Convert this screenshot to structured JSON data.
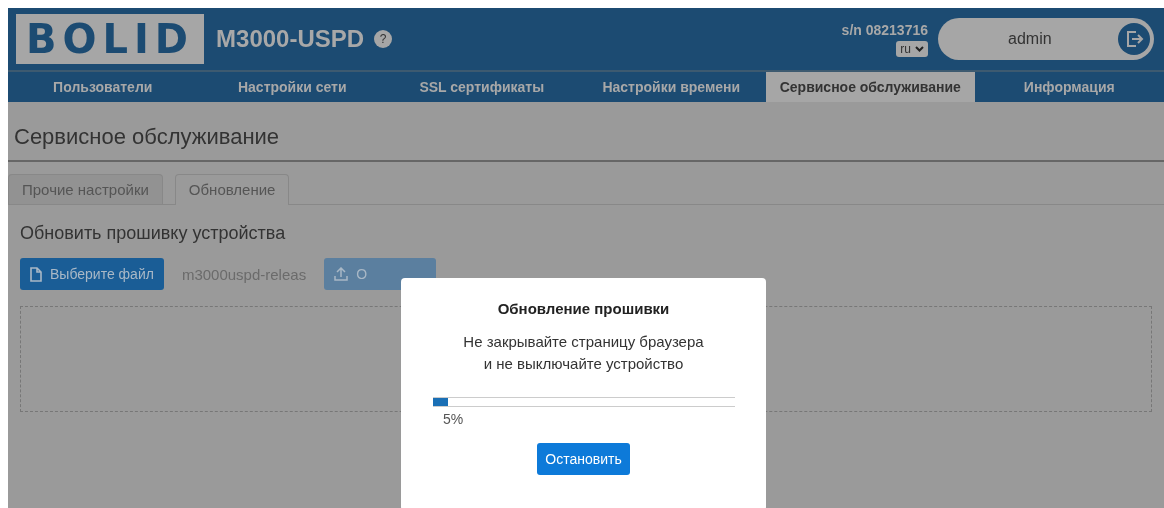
{
  "header": {
    "logo": "BOLID",
    "device": "M3000-USPD",
    "help": "?",
    "serial": "s/n 08213716",
    "language": "ru",
    "user": "admin"
  },
  "nav": [
    {
      "label": "Пользователи",
      "selected": false
    },
    {
      "label": "Настройки сети",
      "selected": false
    },
    {
      "label": "SSL сертификаты",
      "selected": false
    },
    {
      "label": "Настройки времени",
      "selected": false
    },
    {
      "label": "Сервисное обслуживание",
      "selected": true
    },
    {
      "label": "Информация",
      "selected": false
    }
  ],
  "page_title": "Сервисное обслуживание",
  "tabs": [
    {
      "label": "Прочие настройки",
      "selected": false
    },
    {
      "label": "Обновление",
      "selected": true
    }
  ],
  "section": {
    "heading": "Обновить прошивку устройства",
    "file_button": "Выберите файл",
    "file_name": "m3000uspd-releas",
    "upload_button": "О"
  },
  "dialog": {
    "title": "Обновление прошивки",
    "message": [
      "Не закрывайте страницу браузера",
      "и не выключайте устройство"
    ],
    "progress": {
      "level": 0.05,
      "reading": "5%"
    },
    "stop_button": "Остановить"
  }
}
